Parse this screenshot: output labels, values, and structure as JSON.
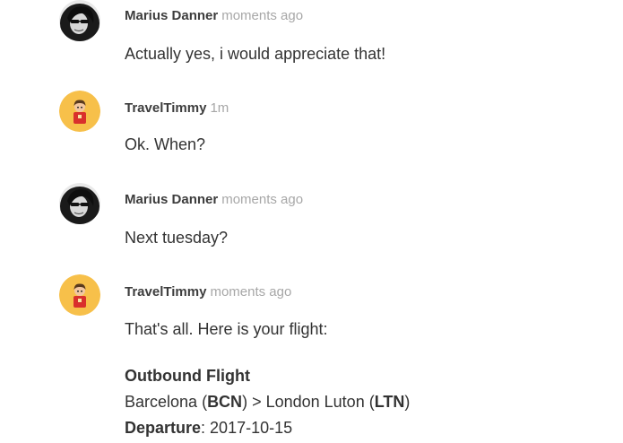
{
  "messages": [
    {
      "author": "Marius Danner",
      "time": "moments ago",
      "text": "Actually yes, i would appreciate that!",
      "avatar_icon": "user-photo-icon"
    },
    {
      "author": "TravelTimmy",
      "time": "1m",
      "text": "Ok. When?",
      "avatar_icon": "bot-avatar-icon"
    },
    {
      "author": "Marius Danner",
      "time": "moments ago",
      "text": "Next tuesday?",
      "avatar_icon": "user-photo-icon"
    },
    {
      "author": "TravelTimmy",
      "time": "moments ago",
      "text": "That's all. Here is your flight:",
      "avatar_icon": "bot-avatar-icon"
    }
  ],
  "flight": {
    "heading": "Outbound Flight",
    "origin": "Barcelona",
    "origin_code": "BCN",
    "separator": ">",
    "destination": "London Luton",
    "destination_code": "LTN",
    "departure_label": "Departure",
    "departure_date": "2017-10-15"
  },
  "colors": {
    "bot_avatar_bg": "#f7c04a",
    "bot_shirt": "#d9302c",
    "time_text": "#a7a7a7",
    "author_text": "#3d3d3d"
  }
}
